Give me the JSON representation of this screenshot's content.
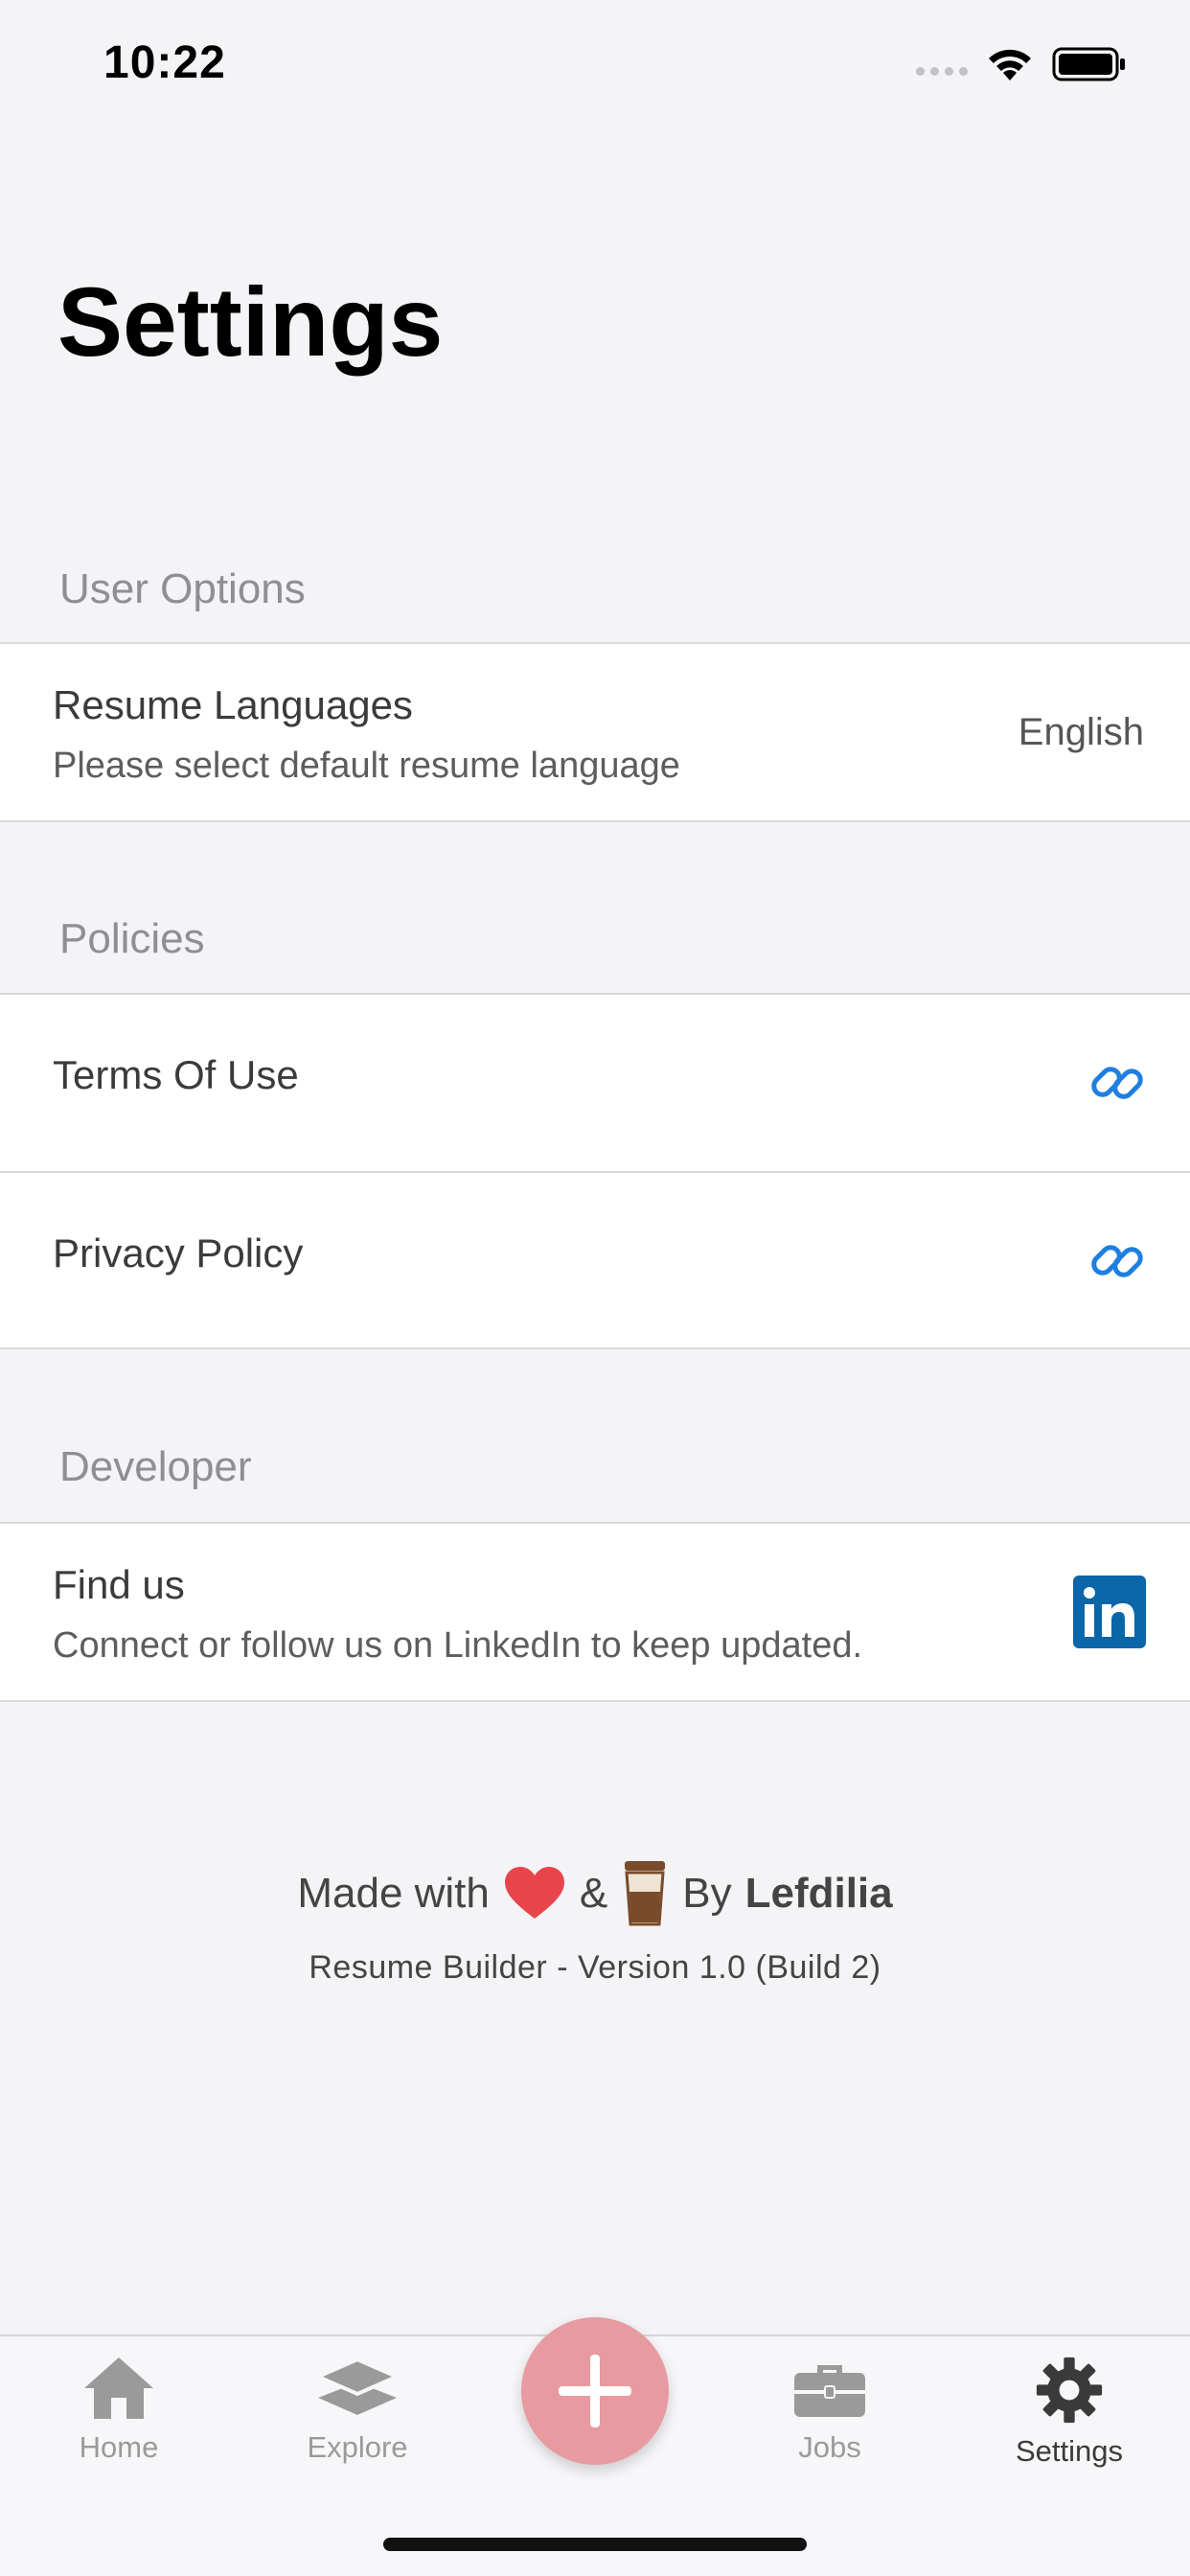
{
  "status_bar": {
    "time": "10:22"
  },
  "page": {
    "title": "Settings"
  },
  "sections": {
    "user_options": {
      "header": "User Options",
      "resume_languages": {
        "title": "Resume Languages",
        "subtitle": "Please select default resume language",
        "value": "English"
      }
    },
    "policies": {
      "header": "Policies",
      "terms": {
        "title": "Terms Of Use",
        "icon": "link-icon"
      },
      "privacy": {
        "title": "Privacy Policy",
        "icon": "link-icon"
      }
    },
    "developer": {
      "header": "Developer",
      "find_us": {
        "title": "Find us",
        "subtitle": "Connect or follow us on LinkedIn to keep updated.",
        "icon": "linkedin-icon"
      }
    }
  },
  "footer": {
    "made_with": "Made with",
    "ampersand": "&",
    "by": "By",
    "brand": "Lefdilia",
    "version": "Resume Builder - Version 1.0 (Build 2)"
  },
  "tab_bar": {
    "home": "Home",
    "explore": "Explore",
    "jobs": "Jobs",
    "settings": "Settings",
    "active": "settings"
  },
  "colors": {
    "accent_link": "#1f7fe0",
    "linkedin": "#0a66a8",
    "add_button": "#e79a9f",
    "heart": "#e8454b"
  }
}
